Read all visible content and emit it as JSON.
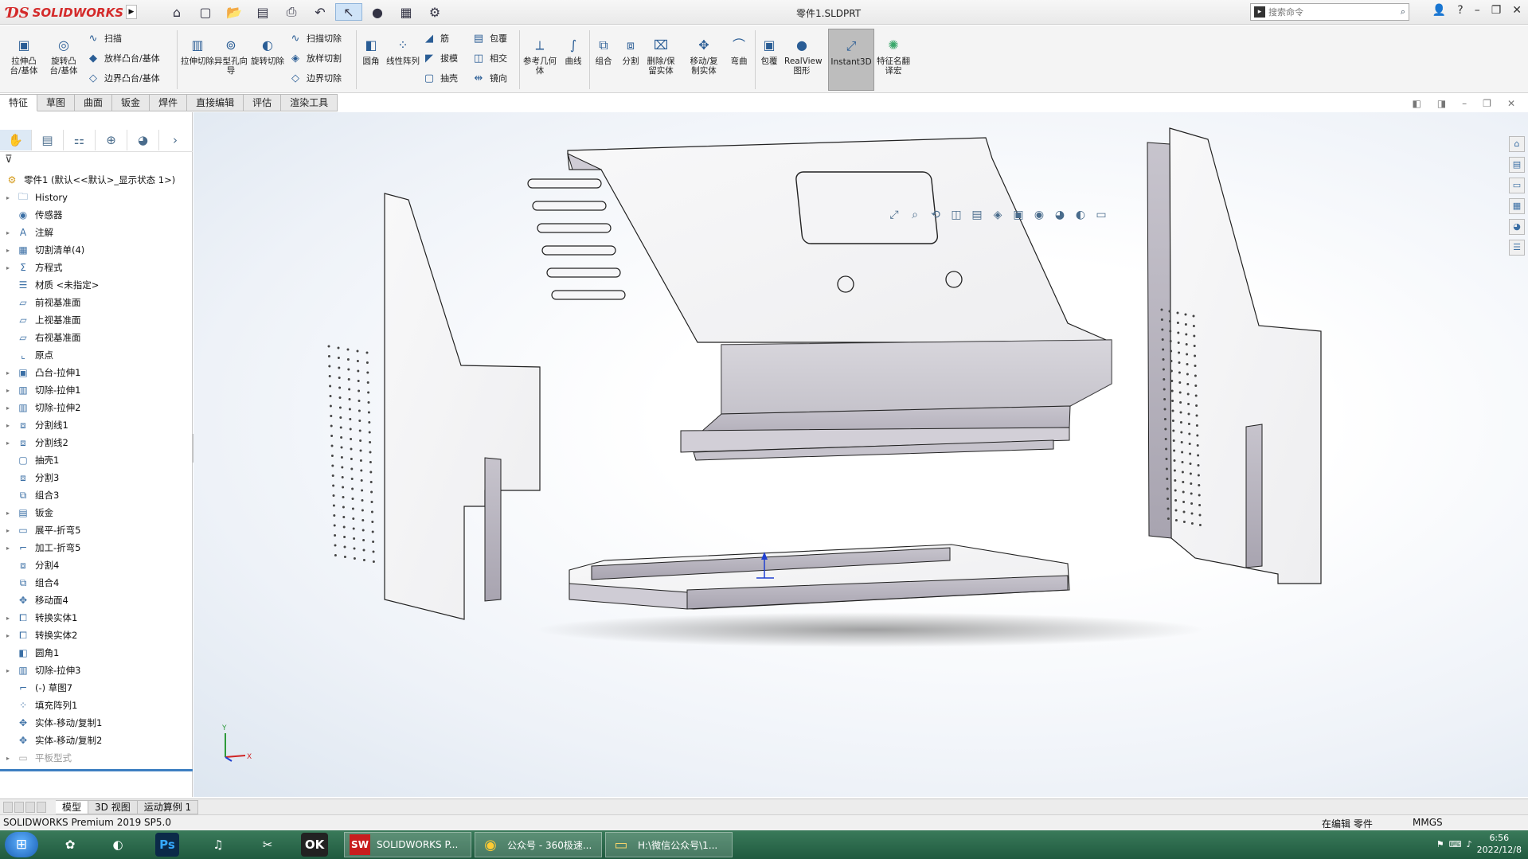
{
  "app": {
    "brand": "SOLIDWORKS",
    "document_title": "零件1.SLDPRT",
    "search_placeholder": "搜索命令"
  },
  "ribbon": {
    "col1": [
      {
        "label": "拉伸凸台/基体",
        "icon": "extrude-boss-icon"
      },
      {
        "label": "旋转凸台/基体",
        "icon": "revolve-boss-icon"
      }
    ],
    "col2": [
      {
        "label": "扫描",
        "icon": "sweep-icon"
      },
      {
        "label": "放样凸台/基体",
        "icon": "loft-icon"
      },
      {
        "label": "边界凸台/基体",
        "icon": "boundary-icon"
      }
    ],
    "col3": [
      {
        "label": "拉伸切除",
        "icon": "extrude-cut-icon"
      },
      {
        "label": "异型孔向导",
        "icon": "hole-wizard-icon"
      },
      {
        "label": "旋转切除",
        "icon": "revolve-cut-icon"
      }
    ],
    "col4": [
      {
        "label": "扫描切除",
        "icon": "sweep-cut-icon"
      },
      {
        "label": "放样切割",
        "icon": "loft-cut-icon"
      },
      {
        "label": "边界切除",
        "icon": "boundary-cut-icon"
      }
    ],
    "col5": [
      {
        "label": "圆角",
        "icon": "fillet-icon"
      },
      {
        "label": "线性阵列",
        "icon": "linear-pattern-icon"
      }
    ],
    "col6": [
      {
        "label": "筋",
        "icon": "rib-icon"
      },
      {
        "label": "拔模",
        "icon": "draft-icon"
      },
      {
        "label": "抽壳",
        "icon": "shell-icon"
      }
    ],
    "col7": [
      {
        "label": "包覆",
        "icon": "wrap-icon"
      },
      {
        "label": "相交",
        "icon": "intersect-icon"
      },
      {
        "label": "镜向",
        "icon": "mirror-icon"
      }
    ],
    "col8": [
      {
        "label": "参考几何体",
        "icon": "reference-geometry-icon"
      },
      {
        "label": "曲线",
        "icon": "curves-icon"
      }
    ],
    "col9": [
      {
        "label": "组合",
        "icon": "combine-icon"
      },
      {
        "label": "分割",
        "icon": "split-icon"
      },
      {
        "label": "删除/保留实体",
        "icon": "delete-body-icon"
      },
      {
        "label": "移动/复制实体",
        "icon": "move-copy-icon"
      },
      {
        "label": "弯曲",
        "icon": "flex-icon"
      },
      {
        "label": "包覆",
        "icon": "wrap2-icon"
      },
      {
        "label": "RealView 图形",
        "icon": "realview-icon"
      },
      {
        "label": "Instant3D",
        "icon": "instant3d-icon"
      },
      {
        "label": "特征名翻译宏",
        "icon": "macro-icon"
      }
    ]
  },
  "command_tabs": [
    "特征",
    "草图",
    "曲面",
    "钣金",
    "焊件",
    "直接编辑",
    "评估",
    "渲染工具"
  ],
  "tree": {
    "root": "零件1 (默认<<默认>_显示状态 1>)",
    "nodes": [
      {
        "label": "History",
        "expandable": true
      },
      {
        "label": "传感器",
        "expandable": false
      },
      {
        "label": "注解",
        "expandable": true
      },
      {
        "label": "切割清单(4)",
        "expandable": true
      },
      {
        "label": "方程式",
        "expandable": true
      },
      {
        "label": "材质 <未指定>",
        "expandable": false
      },
      {
        "label": "前视基准面",
        "expandable": false
      },
      {
        "label": "上视基准面",
        "expandable": false
      },
      {
        "label": "右视基准面",
        "expandable": false
      },
      {
        "label": "原点",
        "expandable": false
      },
      {
        "label": "凸台-拉伸1",
        "expandable": true
      },
      {
        "label": "切除-拉伸1",
        "expandable": true
      },
      {
        "label": "切除-拉伸2",
        "expandable": true
      },
      {
        "label": "分割线1",
        "expandable": true
      },
      {
        "label": "分割线2",
        "expandable": true
      },
      {
        "label": "抽壳1",
        "expandable": false
      },
      {
        "label": "分割3",
        "expandable": false
      },
      {
        "label": "组合3",
        "expandable": false
      },
      {
        "label": "钣金",
        "expandable": true
      },
      {
        "label": "展平-折弯5",
        "expandable": true
      },
      {
        "label": "加工-折弯5",
        "expandable": true
      },
      {
        "label": "分割4",
        "expandable": false
      },
      {
        "label": "组合4",
        "expandable": false
      },
      {
        "label": "移动面4",
        "expandable": false
      },
      {
        "label": "转换实体1",
        "expandable": true
      },
      {
        "label": "转换实体2",
        "expandable": true
      },
      {
        "label": "圆角1",
        "expandable": false
      },
      {
        "label": "切除-拉伸3",
        "expandable": true
      },
      {
        "label": "(-) 草图7",
        "expandable": false
      },
      {
        "label": "填充阵列1",
        "expandable": false
      },
      {
        "label": "实体-移动/复制1",
        "expandable": false
      },
      {
        "label": "实体-移动/复制2",
        "expandable": false
      },
      {
        "label": "平板型式",
        "expandable": true,
        "dim": true
      }
    ]
  },
  "bottom_tabs": [
    "模型",
    "3D 视图",
    "运动算例 1"
  ],
  "status": {
    "product": "SOLIDWORKS Premium 2019 SP5.0",
    "editing": "在编辑 零件",
    "units": "MMGS"
  },
  "taskbar": {
    "apps": [
      {
        "label": "SOLIDWORKS P...",
        "badge": "SW"
      },
      {
        "label": "公众号 - 360极速...",
        "badge": "◉"
      },
      {
        "label": "H:\\微信公众号\\1...",
        "badge": "▭"
      }
    ],
    "time": "6:56",
    "date": "2022/12/8"
  },
  "axis": {
    "x": "X",
    "y": "Y"
  },
  "colors": {
    "accent": "#3d7fc1",
    "part_light": "#f7f7f8",
    "part_dark": "#b5b2bd"
  }
}
